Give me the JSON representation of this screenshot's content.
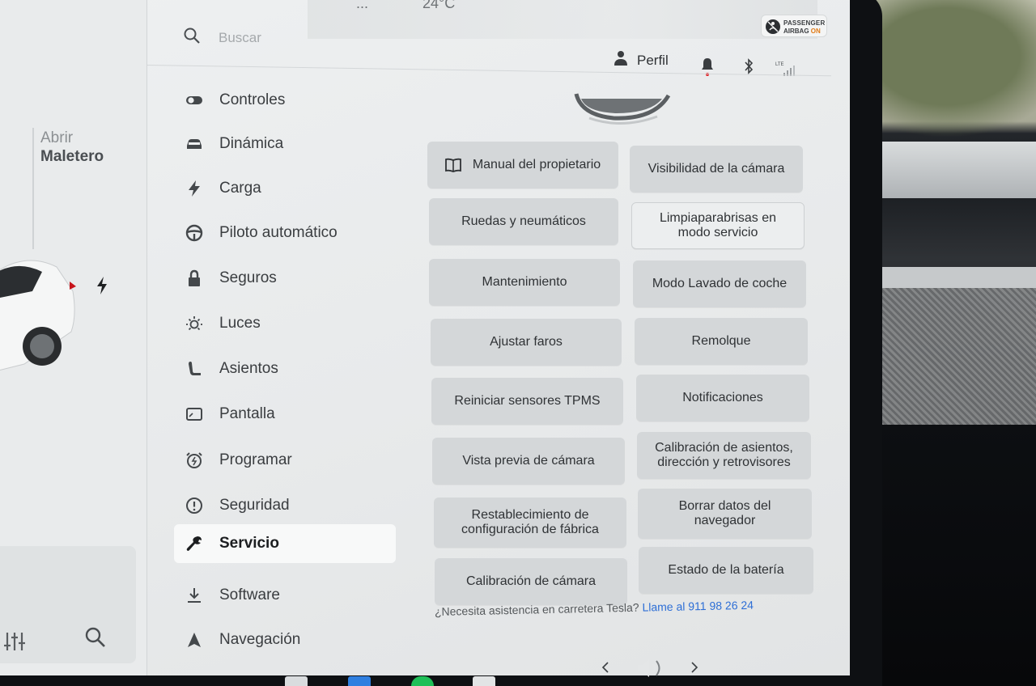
{
  "top_bar": {
    "status_left": "...",
    "temperature": "24°C",
    "airbag_line1": "PASSENGER",
    "airbag_line2": "AIRBAG",
    "airbag_state": "ON"
  },
  "vehicle_panel": {
    "trunk_open": "Abrir",
    "trunk_label": "Maletero"
  },
  "search": {
    "placeholder": "Buscar"
  },
  "header": {
    "profile": "Perfil"
  },
  "sidebar": {
    "items": [
      {
        "label": "Controles",
        "icon": "toggle-icon"
      },
      {
        "label": "Dinámica",
        "icon": "car-icon"
      },
      {
        "label": "Carga",
        "icon": "bolt-icon"
      },
      {
        "label": "Piloto automático",
        "icon": "steering-wheel-icon"
      },
      {
        "label": "Seguros",
        "icon": "lock-icon"
      },
      {
        "label": "Luces",
        "icon": "sun-icon"
      },
      {
        "label": "Asientos",
        "icon": "seat-icon"
      },
      {
        "label": "Pantalla",
        "icon": "display-icon"
      },
      {
        "label": "Programar",
        "icon": "alarm-clock-icon"
      },
      {
        "label": "Seguridad",
        "icon": "alert-circle-icon"
      },
      {
        "label": "Servicio",
        "icon": "wrench-icon",
        "active": true
      },
      {
        "label": "Software",
        "icon": "download-icon"
      },
      {
        "label": "Navegación",
        "icon": "navigation-icon"
      }
    ]
  },
  "service": {
    "buttons": [
      "Manual del propietario",
      "Visibilidad de la cámara",
      "Ruedas y neumáticos",
      "Limpiaparabrisas en modo servicio",
      "Mantenimiento",
      "Modo Lavado de coche",
      "Ajustar faros",
      "Remolque",
      "Reiniciar sensores TPMS",
      "Notificaciones",
      "Vista previa de cámara",
      "Calibración de asientos, dirección y retrovisores",
      "Restablecimiento de configuración de fábrica",
      "Borrar datos del navegador",
      "Calibración de cámara",
      "Estado de la batería"
    ],
    "assist_text": "¿Necesita asistencia en carretera Tesla?",
    "assist_phone": "Llame al 911 98 26 24"
  },
  "colors": {
    "accent_link": "#2e6fd6",
    "airbag_on": "#e07a16",
    "notification_dot": "#e0262b"
  }
}
